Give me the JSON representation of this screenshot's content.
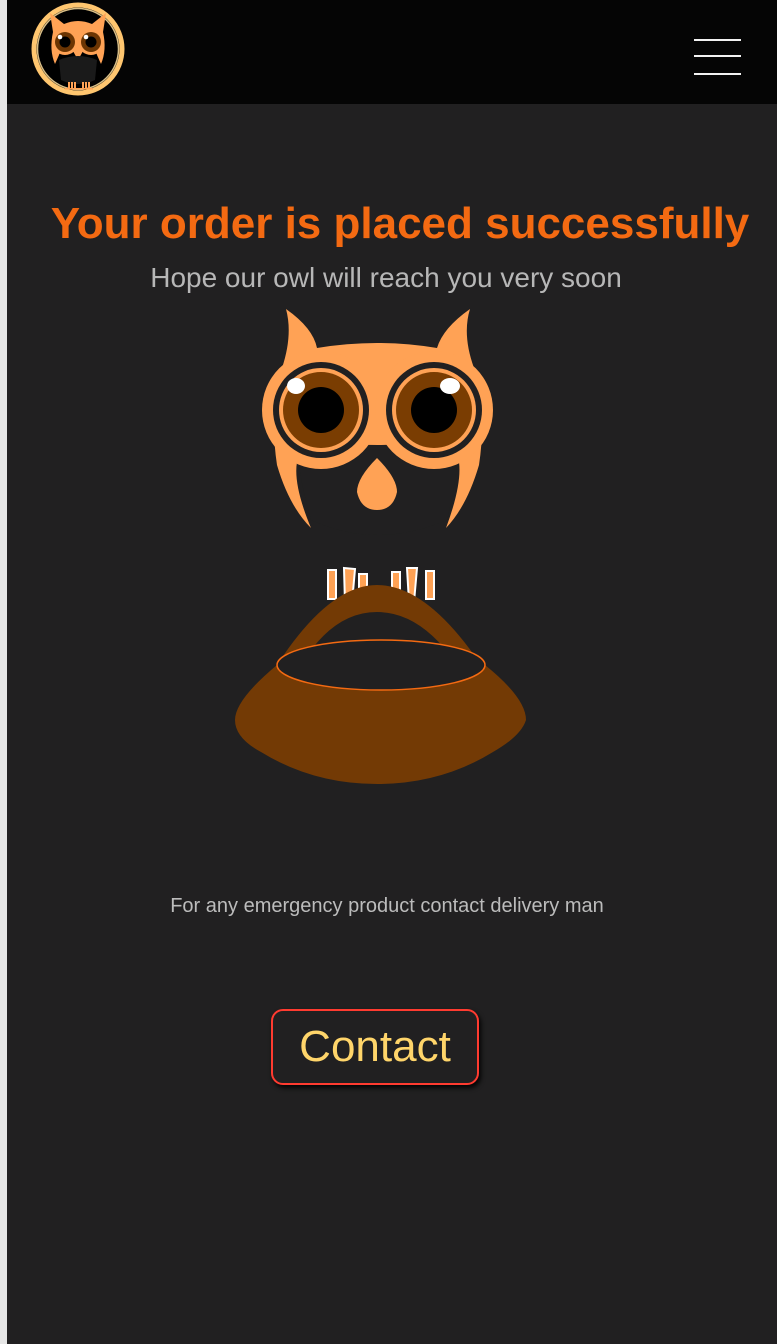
{
  "header": {
    "logo_icon": "owl-logo-icon",
    "menu_icon": "hamburger-menu-icon"
  },
  "main": {
    "title": "Your order is placed successfully",
    "subtitle": "Hope our owl will reach you very soon",
    "illustration_icon": "owl-with-basket-icon",
    "note": "For any emergency product contact delivery man",
    "contact_label": "Contact"
  },
  "colors": {
    "title": "#f46a12",
    "owl": "#ffa255",
    "basket": "#733a05",
    "button_border": "#ff3b30",
    "button_text": "#ffd56a",
    "background": "#212021",
    "topbar": "#050505"
  }
}
